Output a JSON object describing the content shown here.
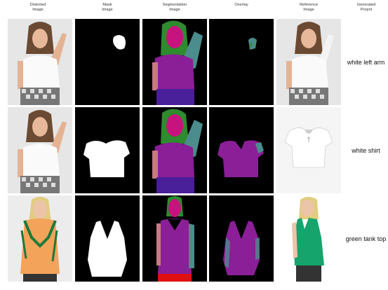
{
  "headers": {
    "distorted": "Distorted\nImage",
    "mask": "Mask\nImage",
    "segmentation": "Segmentation\nImage",
    "overlay": "Overlay",
    "reference": "Reference\nImage",
    "prompt": "Generated\nPropnt"
  },
  "rows": [
    {
      "prompt": "white left arm"
    },
    {
      "prompt": "white shirt"
    },
    {
      "prompt": "green tank top"
    }
  ],
  "colors": {
    "hair": "#2e8b2e",
    "face": "#c8137e",
    "shirt": "#8a1f97",
    "arm": "#4b8c8c",
    "skin_arm": "#c77a86",
    "pants": "#4a1f9a",
    "red": "#e01010",
    "mask": "#ffffff",
    "tank_green": "#14a46c",
    "distorted_orange": "#f4a35a"
  }
}
